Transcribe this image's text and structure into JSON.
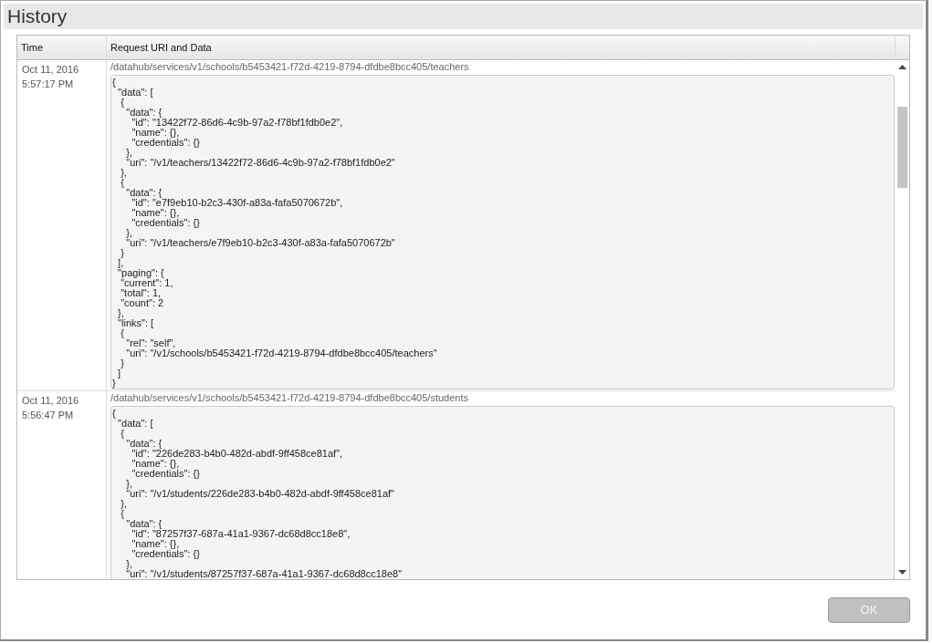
{
  "window": {
    "title": "History"
  },
  "table": {
    "columns": [
      "Time",
      "Request URI and Data"
    ],
    "rows": [
      {
        "date": "Oct 11, 2016",
        "time": "5:57:17 PM",
        "uri": "/datahub/services/v1/schools/b5453421-f72d-4219-8794-dfdbe8bcc405/teachers",
        "data_lines": [
          "{",
          "  \"data\": [",
          "   {",
          "     \"data\": {",
          "       \"id\": \"13422f72-86d6-4c9b-97a2-f78bf1fdb0e2\",",
          "       \"name\": {},",
          "       \"credentials\": {}",
          "     },",
          "     \"uri\": \"/v1/teachers/13422f72-86d6-4c9b-97a2-f78bf1fdb0e2\"",
          "   },",
          "   {",
          "     \"data\": {",
          "       \"id\": \"e7f9eb10-b2c3-430f-a83a-fafa5070672b\",",
          "       \"name\": {},",
          "       \"credentials\": {}",
          "     },",
          "     \"uri\": \"/v1/teachers/e7f9eb10-b2c3-430f-a83a-fafa5070672b\"",
          "   }",
          "  ],",
          "  \"paging\": {",
          "   \"current\": 1,",
          "   \"total\": 1,",
          "   \"count\": 2",
          "  },",
          "  \"links\": [",
          "   {",
          "     \"rel\": \"self\",",
          "     \"uri\": \"/v1/schools/b5453421-f72d-4219-8794-dfdbe8bcc405/teachers\"",
          "   }",
          "  ]",
          "}"
        ]
      },
      {
        "date": "Oct 11, 2016",
        "time": "5:56:47 PM",
        "uri": "/datahub/services/v1/schools/b5453421-f72d-4219-8794-dfdbe8bcc405/students",
        "data_lines": [
          "{",
          "  \"data\": [",
          "   {",
          "     \"data\": {",
          "       \"id\": \"226de283-b4b0-482d-abdf-9ff458ce81af\",",
          "       \"name\": {},",
          "       \"credentials\": {}",
          "     },",
          "     \"uri\": \"/v1/students/226de283-b4b0-482d-abdf-9ff458ce81af\"",
          "   },",
          "   {",
          "     \"data\": {",
          "       \"id\": \"87257f37-687a-41a1-9367-dc68d8cc18e8\",",
          "       \"name\": {},",
          "       \"credentials\": {}",
          "     },",
          "     \"uri\": \"/v1/students/87257f37-687a-41a1-9367-dc68d8cc18e8\""
        ]
      }
    ]
  },
  "ok_button": {
    "label": "OK",
    "disabled": true
  }
}
